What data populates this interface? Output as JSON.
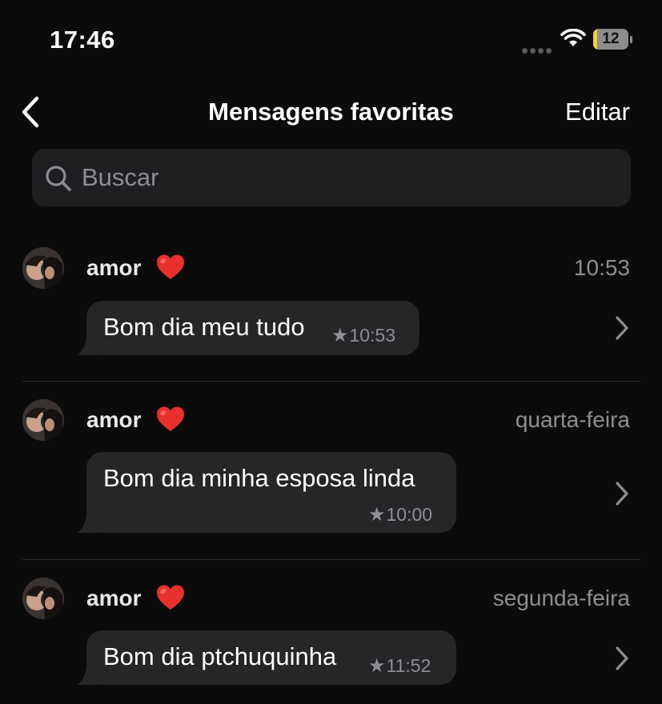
{
  "status_bar": {
    "time": "17:46",
    "battery_level": "12",
    "battery_fraction": 0.12
  },
  "nav": {
    "back_icon": "chevron-left-icon",
    "title": "Mensagens favoritas",
    "edit_label": "Editar"
  },
  "search": {
    "placeholder": "Buscar",
    "value": ""
  },
  "messages": [
    {
      "sender": "amor",
      "date": "10:53",
      "text": "Bom dia meu tudo",
      "time": "10:53",
      "starred": true
    },
    {
      "sender": "amor",
      "date": "quarta-feira",
      "text": "Bom dia minha esposa linda",
      "time": "10:00",
      "starred": true
    },
    {
      "sender": "amor",
      "date": "segunda-feira",
      "text": "Bom dia ptchuquinha",
      "time": "11:52",
      "starred": true
    }
  ],
  "colors": {
    "background": "#0b0b0b",
    "bubble": "#262628",
    "secondary_text": "#8e8e93",
    "battery_accent": "#f2cc3a",
    "heart": "#e8312f"
  },
  "icons": {
    "wifi": "wifi-icon",
    "battery": "battery-icon",
    "search": "search-icon",
    "heart": "heart-icon",
    "star": "star-icon",
    "chevron": "chevron-right-icon"
  }
}
